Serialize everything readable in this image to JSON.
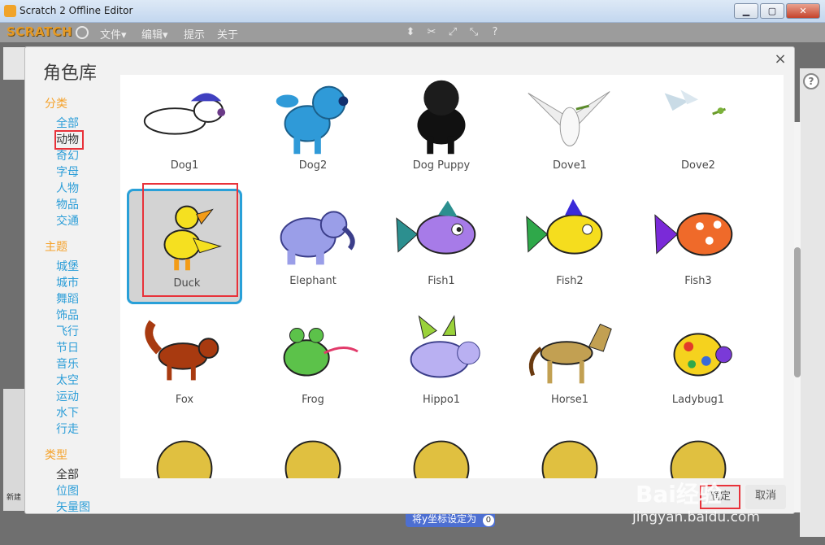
{
  "window": {
    "title": "Scratch 2 Offline Editor",
    "minimize": "▁",
    "maximize": "▢",
    "close": "✕"
  },
  "menubar": {
    "logo": "SCRATCH",
    "items": [
      "文件▾",
      "编辑▾",
      "提示",
      "关于"
    ]
  },
  "background": {
    "new_sprite_label": "新建",
    "block_text": "将y坐标设定为",
    "block_value": "0",
    "watermark": "Bai经验",
    "watermark_url": "jingyan.baidu.com"
  },
  "dialog": {
    "title": "角色库",
    "close": "×",
    "ok_label": "确定",
    "cancel_label": "取消",
    "sidebar": {
      "category_heading": "分类",
      "categories": [
        "全部",
        "动物",
        "奇幻",
        "字母",
        "人物",
        "物品",
        "交通"
      ],
      "theme_heading": "主题",
      "themes": [
        "城堡",
        "城市",
        "舞蹈",
        "饰品",
        "飞行",
        "节日",
        "音乐",
        "太空",
        "运动",
        "水下",
        "行走"
      ],
      "type_heading": "类型",
      "types": [
        "全部",
        "位图",
        "矢量图"
      ]
    },
    "sprites": [
      "Dog1",
      "Dog2",
      "Dog Puppy",
      "Dove1",
      "Dove2",
      "Duck",
      "Elephant",
      "Fish1",
      "Fish2",
      "Fish3",
      "Fox",
      "Frog",
      "Hippo1",
      "Horse1",
      "Ladybug1",
      "",
      "",
      "",
      "",
      ""
    ],
    "selected_sprite": "Duck"
  }
}
